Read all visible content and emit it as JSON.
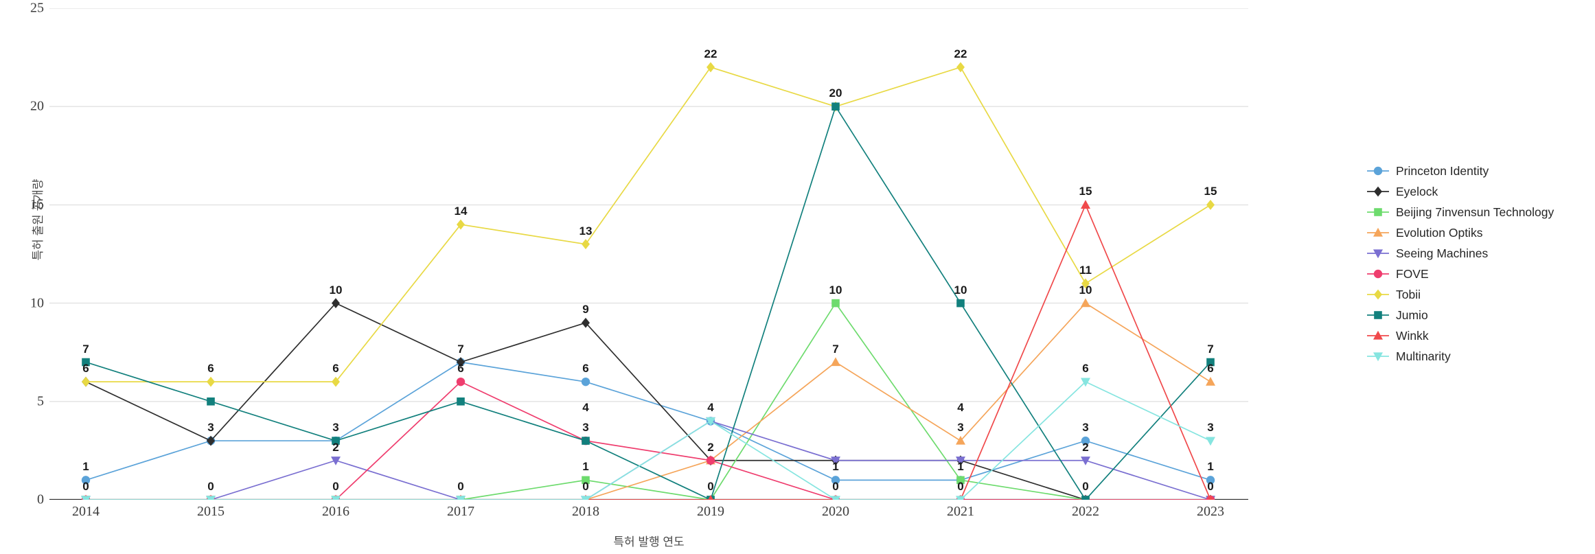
{
  "axes": {
    "y_label": "특허 출원 공개량",
    "x_label": "특허 발행 연도",
    "y_ticks": [
      "0",
      "5",
      "10",
      "15",
      "20",
      "25"
    ],
    "x_ticks": [
      "2014",
      "2015",
      "2016",
      "2017",
      "2018",
      "2019",
      "2020",
      "2021",
      "2022",
      "2023"
    ]
  },
  "legend": {
    "position": "right",
    "items": [
      {
        "label": "Princeton Identity",
        "color": "#5ba3d9",
        "marker": "circle"
      },
      {
        "label": "Eyelock",
        "color": "#2e2e2e",
        "marker": "diamond"
      },
      {
        "label": "Beijing 7invensun Technology",
        "color": "#6ddb6d",
        "marker": "square"
      },
      {
        "label": "Evolution Optiks",
        "color": "#f5a55a",
        "marker": "triangle-up"
      },
      {
        "label": "Seeing Machines",
        "color": "#7a6fd1",
        "marker": "triangle-down"
      },
      {
        "label": "FOVE",
        "color": "#ef3d6e",
        "marker": "circle"
      },
      {
        "label": "Tobii",
        "color": "#e8d944",
        "marker": "diamond"
      },
      {
        "label": "Jumio",
        "color": "#12807d",
        "marker": "square"
      },
      {
        "label": "Winkk",
        "color": "#f0494b",
        "marker": "triangle-up"
      },
      {
        "label": "Multinarity",
        "color": "#86e5e0",
        "marker": "triangle-down"
      }
    ]
  },
  "chart_data": {
    "type": "line",
    "title": "",
    "xlabel": "특허 발행 연도",
    "ylabel": "특허 출원 공개량",
    "x": [
      "2014",
      "2015",
      "2016",
      "2017",
      "2018",
      "2019",
      "2020",
      "2021",
      "2022",
      "2023"
    ],
    "ylim": [
      0,
      25
    ],
    "ytick_values": [
      0,
      5,
      10,
      15,
      20,
      25
    ],
    "grid": "horizontal",
    "legend_position": "right",
    "data_labels": true,
    "series": [
      {
        "name": "Princeton Identity",
        "color": "#5ba3d9",
        "marker": "circle",
        "values": [
          1,
          3,
          3,
          7,
          6,
          4,
          1,
          1,
          3,
          1
        ]
      },
      {
        "name": "Eyelock",
        "color": "#2e2e2e",
        "marker": "diamond",
        "values": [
          6,
          3,
          10,
          7,
          9,
          2,
          2,
          2,
          0,
          0
        ]
      },
      {
        "name": "Beijing 7invensun Technology",
        "color": "#6ddb6d",
        "marker": "square",
        "values": [
          0,
          0,
          0,
          0,
          1,
          0,
          10,
          1,
          0,
          0
        ]
      },
      {
        "name": "Evolution Optiks",
        "color": "#f5a55a",
        "marker": "triangle-up",
        "values": [
          0,
          0,
          0,
          0,
          0,
          2,
          7,
          3,
          10,
          6
        ]
      },
      {
        "name": "Seeing Machines",
        "color": "#7a6fd1",
        "marker": "triangle-down",
        "values": [
          0,
          0,
          2,
          0,
          0,
          4,
          2,
          2,
          2,
          0
        ]
      },
      {
        "name": "FOVE",
        "color": "#ef3d6e",
        "marker": "circle",
        "values": [
          0,
          0,
          0,
          6,
          3,
          2,
          0,
          0,
          0,
          0
        ]
      },
      {
        "name": "Tobii",
        "color": "#e8d944",
        "marker": "diamond",
        "values": [
          6,
          6,
          6,
          14,
          13,
          22,
          20,
          22,
          11,
          15
        ]
      },
      {
        "name": "Jumio",
        "color": "#12807d",
        "marker": "square",
        "values": [
          7,
          5,
          3,
          5,
          3,
          0,
          20,
          10,
          0,
          7
        ]
      },
      {
        "name": "Winkk",
        "color": "#f0494b",
        "marker": "triangle-up",
        "values": [
          0,
          0,
          0,
          0,
          0,
          0,
          0,
          0,
          15,
          0
        ]
      },
      {
        "name": "Multinarity",
        "color": "#86e5e0",
        "marker": "triangle-down",
        "values": [
          0,
          0,
          0,
          0,
          0,
          4,
          0,
          0,
          6,
          3
        ]
      }
    ],
    "point_labels": [
      {
        "x": "2014",
        "y": 7,
        "text": "7"
      },
      {
        "x": "2014",
        "y": 6,
        "text": "6"
      },
      {
        "x": "2014",
        "y": 1,
        "text": "1"
      },
      {
        "x": "2014",
        "y": 0,
        "text": "0"
      },
      {
        "x": "2015",
        "y": 6,
        "text": "6"
      },
      {
        "x": "2015",
        "y": 3,
        "text": "3"
      },
      {
        "x": "2015",
        "y": 0,
        "text": "0"
      },
      {
        "x": "2016",
        "y": 10,
        "text": "10"
      },
      {
        "x": "2016",
        "y": 6,
        "text": "6"
      },
      {
        "x": "2016",
        "y": 3,
        "text": "3"
      },
      {
        "x": "2016",
        "y": 2,
        "text": "2"
      },
      {
        "x": "2016",
        "y": 0,
        "text": "0"
      },
      {
        "x": "2017",
        "y": 14,
        "text": "14"
      },
      {
        "x": "2017",
        "y": 7,
        "text": "7"
      },
      {
        "x": "2017",
        "y": 6,
        "text": "6"
      },
      {
        "x": "2017",
        "y": 0,
        "text": "0"
      },
      {
        "x": "2018",
        "y": 13,
        "text": "13"
      },
      {
        "x": "2018",
        "y": 9,
        "text": "9"
      },
      {
        "x": "2018",
        "y": 6,
        "text": "6"
      },
      {
        "x": "2018",
        "y": 4,
        "text": "4"
      },
      {
        "x": "2018",
        "y": 3,
        "text": "3"
      },
      {
        "x": "2018",
        "y": 1,
        "text": "1"
      },
      {
        "x": "2018",
        "y": 0,
        "text": "0"
      },
      {
        "x": "2019",
        "y": 22,
        "text": "22"
      },
      {
        "x": "2019",
        "y": 4,
        "text": "4"
      },
      {
        "x": "2019",
        "y": 2,
        "text": "2"
      },
      {
        "x": "2019",
        "y": 0,
        "text": "0"
      },
      {
        "x": "2020",
        "y": 20,
        "text": "20"
      },
      {
        "x": "2020",
        "y": 10,
        "text": "10"
      },
      {
        "x": "2020",
        "y": 7,
        "text": "7"
      },
      {
        "x": "2020",
        "y": 1,
        "text": "1"
      },
      {
        "x": "2020",
        "y": 0,
        "text": "0"
      },
      {
        "x": "2021",
        "y": 22,
        "text": "22"
      },
      {
        "x": "2021",
        "y": 10,
        "text": "10"
      },
      {
        "x": "2021",
        "y": 4,
        "text": "4"
      },
      {
        "x": "2021",
        "y": 3,
        "text": "3"
      },
      {
        "x": "2021",
        "y": 1,
        "text": "1"
      },
      {
        "x": "2021",
        "y": 0,
        "text": "0"
      },
      {
        "x": "2022",
        "y": 15,
        "text": "15"
      },
      {
        "x": "2022",
        "y": 11,
        "text": "11"
      },
      {
        "x": "2022",
        "y": 10,
        "text": "10"
      },
      {
        "x": "2022",
        "y": 6,
        "text": "6"
      },
      {
        "x": "2022",
        "y": 3,
        "text": "3"
      },
      {
        "x": "2022",
        "y": 2,
        "text": "2"
      },
      {
        "x": "2022",
        "y": 0,
        "text": "0"
      },
      {
        "x": "2023",
        "y": 15,
        "text": "15"
      },
      {
        "x": "2023",
        "y": 7,
        "text": "7"
      },
      {
        "x": "2023",
        "y": 6,
        "text": "6"
      },
      {
        "x": "2023",
        "y": 3,
        "text": "3"
      },
      {
        "x": "2023",
        "y": 1,
        "text": "1"
      },
      {
        "x": "2023",
        "y": 0,
        "text": "0"
      }
    ]
  }
}
